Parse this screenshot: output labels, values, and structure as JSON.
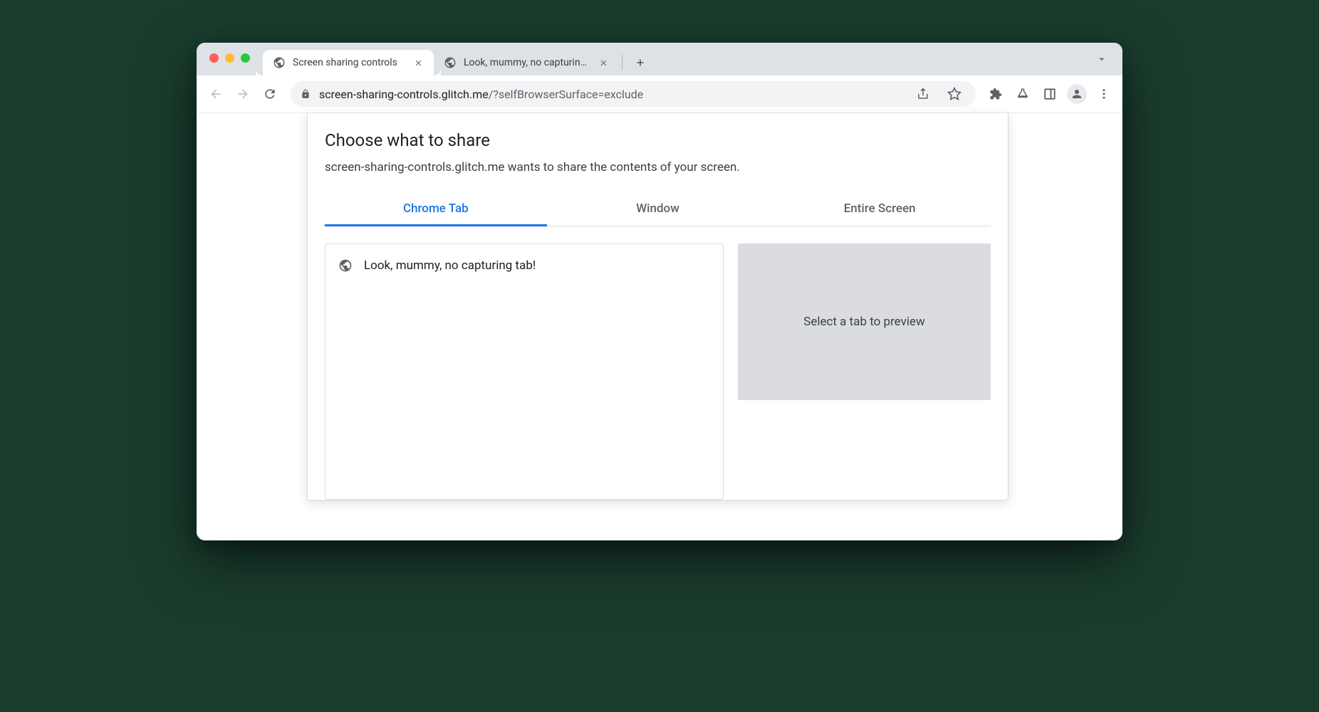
{
  "browser": {
    "tabs": [
      {
        "title": "Screen sharing controls",
        "active": true
      },
      {
        "title": "Look, mummy, no capturing tab",
        "active": false
      }
    ],
    "url_host": "screen-sharing-controls.glitch.me",
    "url_path": "/?selfBrowserSurface=exclude"
  },
  "dialog": {
    "title": "Choose what to share",
    "subtitle": "screen-sharing-controls.glitch.me wants to share the contents of your screen.",
    "tabs": [
      {
        "label": "Chrome Tab",
        "active": true
      },
      {
        "label": "Window",
        "active": false
      },
      {
        "label": "Entire Screen",
        "active": false
      }
    ],
    "tab_list": [
      {
        "label": "Look, mummy, no capturing tab!"
      }
    ],
    "preview_placeholder": "Select a tab to preview"
  }
}
